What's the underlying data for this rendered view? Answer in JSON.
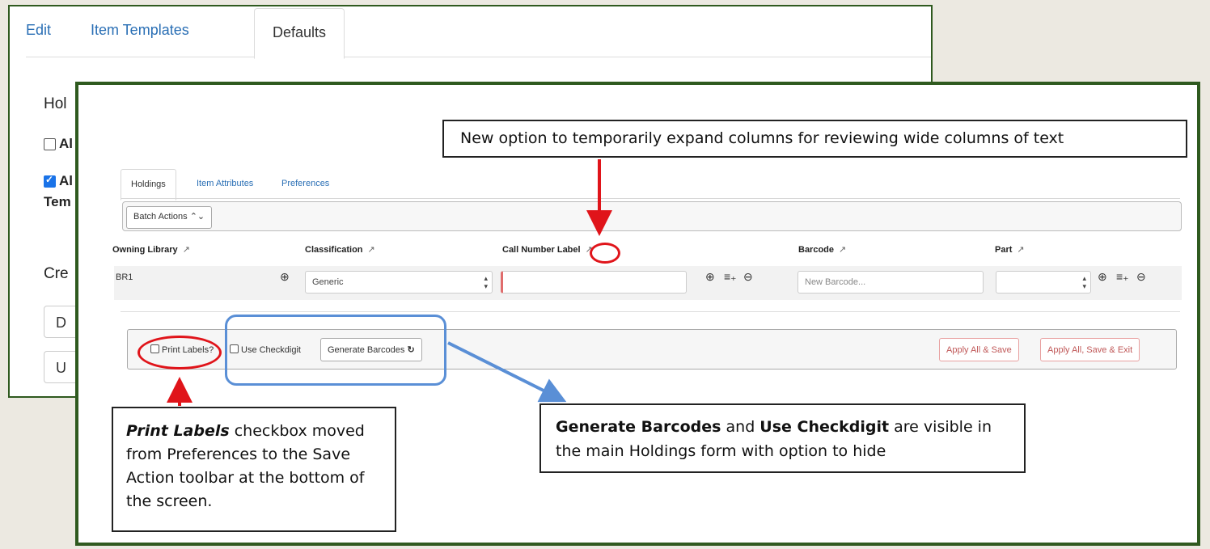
{
  "back_panel": {
    "tabs": [
      "Edit",
      "Item Templates",
      "Defaults"
    ],
    "section_heading": "Hol",
    "checkbox1": "Al",
    "checkbox2_line1": "Al",
    "checkbox2_line2": "Tem",
    "section2_heading": "Cre",
    "btn1": "D",
    "btn2": "U"
  },
  "front_panel": {
    "tabs": [
      "Holdings",
      "Item Attributes",
      "Preferences"
    ],
    "batch_actions": "Batch Actions",
    "columns": [
      "Owning Library",
      "Classification",
      "Call Number Label",
      "Barcode",
      "Part"
    ],
    "row": {
      "owning_library": "BR1",
      "classification": "Generic",
      "call_number": "",
      "barcode_placeholder": "New Barcode...",
      "part": ""
    },
    "toolbar": {
      "print_labels": "Print Labels?",
      "use_checkdigit": "Use Checkdigit",
      "generate_barcodes": "Generate Barcodes",
      "apply_all_save": "Apply All & Save",
      "apply_all_save_exit": "Apply All, Save & Exit"
    }
  },
  "callouts": {
    "top": "New option to temporarily expand columns for reviewing wide columns of text",
    "left_bold": "Print Labels",
    "left_rest": " checkbox moved from Preferences to the Save Action toolbar at the bottom of the screen.",
    "right_bold1": "Generate Barcodes",
    "right_and": " and ",
    "right_bold2": "Use Checkdigit",
    "right_rest": " are visible in the main Holdings form with option to hide"
  },
  "colors": {
    "frame_green": "#2f5a1f",
    "annotation_red": "#e0141a",
    "annotation_blue": "#5a8fd6",
    "link_blue": "#2a6fb5",
    "background": "#ece9e1"
  }
}
